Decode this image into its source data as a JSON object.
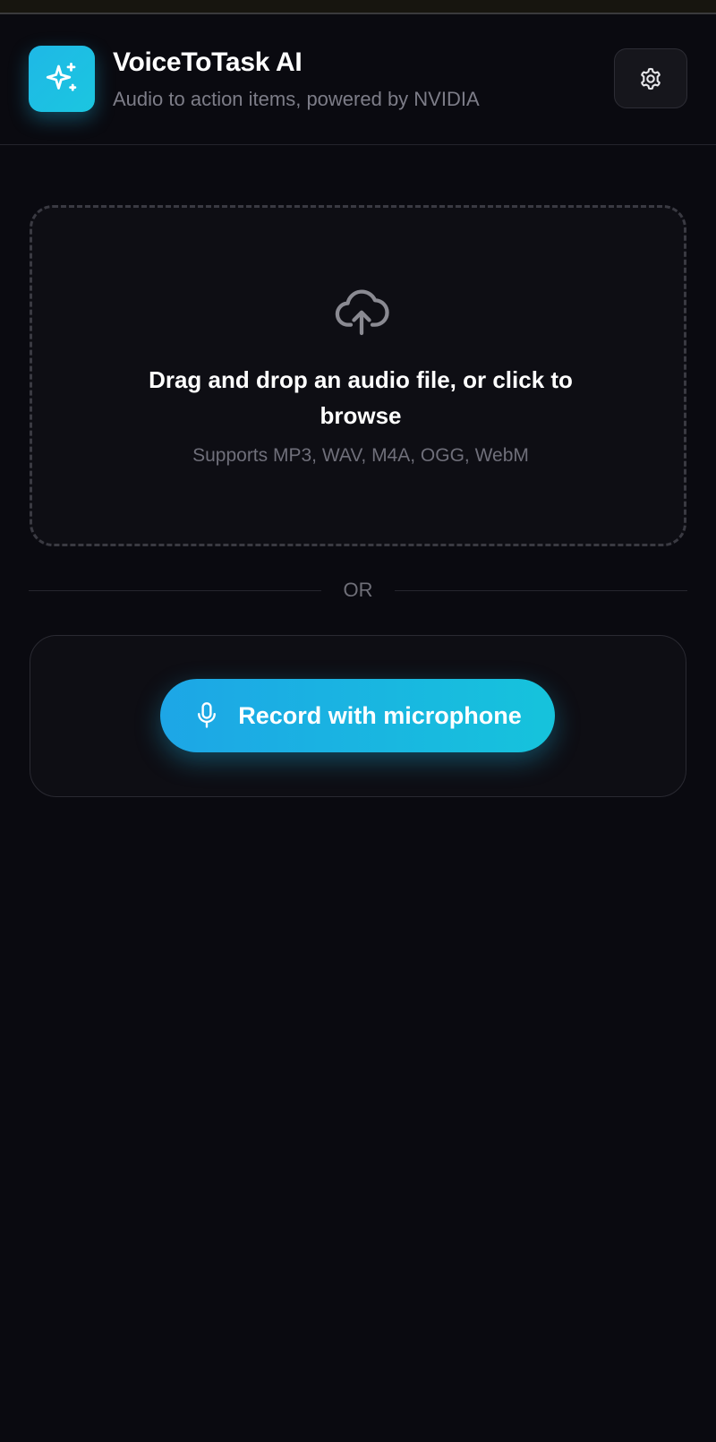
{
  "header": {
    "title": "VoiceToTask AI",
    "subtitle": "Audio to action items, powered by NVIDIA",
    "logo_icon": "sparkles-icon",
    "settings_icon": "gear-icon"
  },
  "upload": {
    "icon": "cloud-upload-icon",
    "title": "Drag and drop an audio file, or click to browse",
    "hint": "Supports MP3, WAV, M4A, OGG, WebM"
  },
  "divider": {
    "label": "OR"
  },
  "record": {
    "icon": "microphone-icon",
    "label": "Record with microphone"
  },
  "colors": {
    "background": "#0a0a10",
    "accent_start": "#1da6e6",
    "accent_end": "#16c3dc",
    "muted_text": "#7d7d88"
  }
}
